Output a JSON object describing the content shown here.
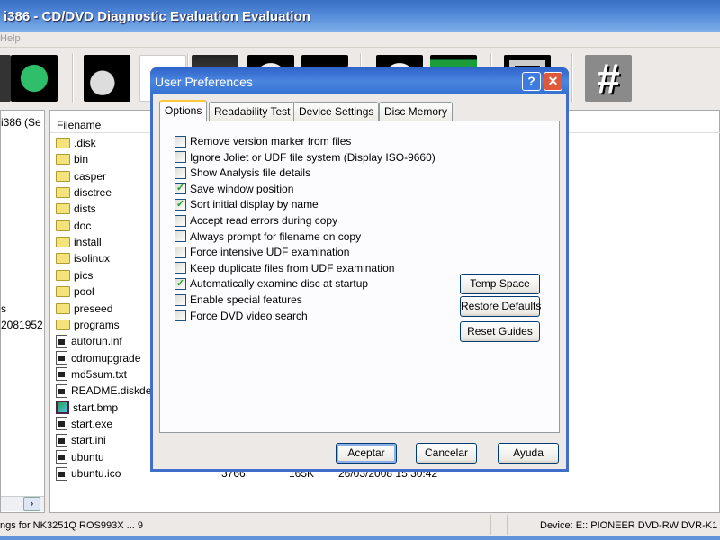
{
  "window": {
    "title": "i386 - CD/DVD Diagnostic Evaluation Evaluation"
  },
  "menu": {
    "items": [
      "Help"
    ]
  },
  "toolbar": {
    "icons": [
      "drive-icon",
      "refresh-icon",
      "disc-scan-icon",
      "checklist-icon",
      "device-icon",
      "disc-icon",
      "disc-write-icon",
      "disc-tray-icon",
      "upload-icon",
      "memory-icon",
      "hash-icon"
    ]
  },
  "tree": {
    "header": "i386 (Se",
    "lines": [
      "s",
      "2081952"
    ]
  },
  "filelist": {
    "header": "Filename",
    "rows": [
      {
        "name": ".disk",
        "type": "folder"
      },
      {
        "name": "bin",
        "type": "folder"
      },
      {
        "name": "casper",
        "type": "folder"
      },
      {
        "name": "disctree",
        "type": "folder"
      },
      {
        "name": "dists",
        "type": "folder"
      },
      {
        "name": "doc",
        "type": "folder"
      },
      {
        "name": "install",
        "type": "folder"
      },
      {
        "name": "isolinux",
        "type": "folder"
      },
      {
        "name": "pics",
        "type": "folder"
      },
      {
        "name": "pool",
        "type": "folder"
      },
      {
        "name": "preseed",
        "type": "folder"
      },
      {
        "name": "programs",
        "type": "folder"
      },
      {
        "name": "autorun.inf",
        "type": "file"
      },
      {
        "name": "cdromupgrade",
        "type": "file"
      },
      {
        "name": "md5sum.txt",
        "type": "file"
      },
      {
        "name": "README.diskdef",
        "type": "file"
      },
      {
        "name": "start.bmp",
        "type": "image"
      },
      {
        "name": "start.exe",
        "type": "file"
      },
      {
        "name": "start.ini",
        "type": "file"
      },
      {
        "name": "ubuntu",
        "type": "file"
      },
      {
        "name": "ubuntu.ico",
        "type": "file",
        "extra": [
          "3766",
          "165K",
          "26/03/2008 15:30:42"
        ]
      }
    ]
  },
  "statusbar": {
    "left": "ngs for NK3251Q ROS993X ... 9",
    "right": "Device: E:: PIONEER DVD-RW DVR-K1"
  },
  "dialog": {
    "title": "User Preferences",
    "help_label": "?",
    "close_label": "✕",
    "tabs": [
      {
        "label": "Options",
        "active": true
      },
      {
        "label": "Readability Test"
      },
      {
        "label": "Device Settings"
      },
      {
        "label": "Disc Memory"
      }
    ],
    "options": [
      {
        "label": "Remove version marker from files",
        "checked": false
      },
      {
        "label": "Ignore Joliet or UDF file system (Display ISO-9660)",
        "checked": false
      },
      {
        "label": "Show Analysis file details",
        "checked": false
      },
      {
        "label": "Save window position",
        "checked": true
      },
      {
        "label": "Sort initial display by name",
        "checked": true
      },
      {
        "label": "Accept read errors during copy",
        "checked": false
      },
      {
        "label": "Always prompt for filename on copy",
        "checked": false
      },
      {
        "label": "Force intensive UDF examination",
        "checked": false
      },
      {
        "label": "Keep duplicate files from UDF examination",
        "checked": false
      },
      {
        "label": "Automatically examine disc at startup",
        "checked": true
      },
      {
        "label": "Enable special features",
        "checked": false
      },
      {
        "label": "Force DVD video search",
        "checked": false
      }
    ],
    "side_buttons": [
      "Temp Space",
      "Restore Defaults",
      "Reset Guides"
    ],
    "ok": "Aceptar",
    "cancel": "Cancelar",
    "help": "Ayuda"
  },
  "colors": {
    "titlebar": "#4f86d6",
    "dialog_frame": "#3f6fc8",
    "check": "#21a121"
  }
}
